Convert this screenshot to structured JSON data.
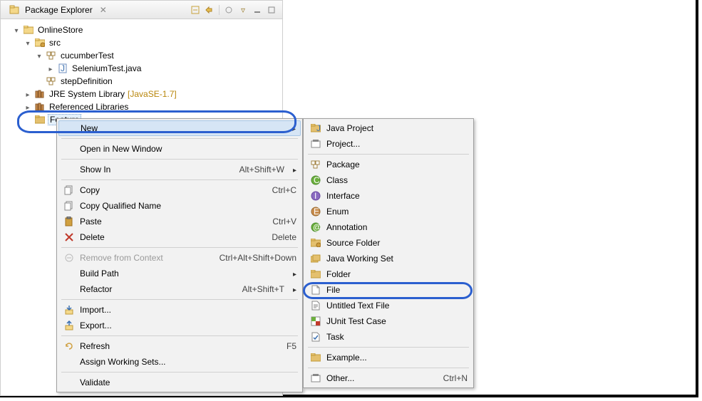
{
  "explorer": {
    "title": "Package Explorer",
    "tree": {
      "project": "OnlineStore",
      "src": "src",
      "pkg": "cucumberTest",
      "file": "SeleniumTest.java",
      "stepdef": "stepDefinition",
      "jre": "JRE System Library",
      "jreQualifier": "[JavaSE-1.7]",
      "refLibs": "Referenced Libraries",
      "feature": "Feature"
    }
  },
  "ctx": {
    "new": "New",
    "openNewWin": "Open in New Window",
    "showIn": "Show In",
    "showInKey": "Alt+Shift+W",
    "copy": "Copy",
    "copyKey": "Ctrl+C",
    "copyQualified": "Copy Qualified Name",
    "paste": "Paste",
    "pasteKey": "Ctrl+V",
    "delete": "Delete",
    "deleteKey": "Delete",
    "removeCtx": "Remove from Context",
    "removeCtxKey": "Ctrl+Alt+Shift+Down",
    "buildPath": "Build Path",
    "refactor": "Refactor",
    "refactorKey": "Alt+Shift+T",
    "import": "Import...",
    "export": "Export...",
    "refresh": "Refresh",
    "refreshKey": "F5",
    "assignWS": "Assign Working Sets...",
    "validate": "Validate"
  },
  "newMenu": {
    "javaProject": "Java Project",
    "project": "Project...",
    "package": "Package",
    "class": "Class",
    "interface": "Interface",
    "enum": "Enum",
    "annotation": "Annotation",
    "sourceFolder": "Source Folder",
    "javaWS": "Java Working Set",
    "folder": "Folder",
    "file": "File",
    "untitled": "Untitled Text File",
    "junit": "JUnit Test Case",
    "task": "Task",
    "example": "Example...",
    "other": "Other...",
    "otherKey": "Ctrl+N"
  }
}
